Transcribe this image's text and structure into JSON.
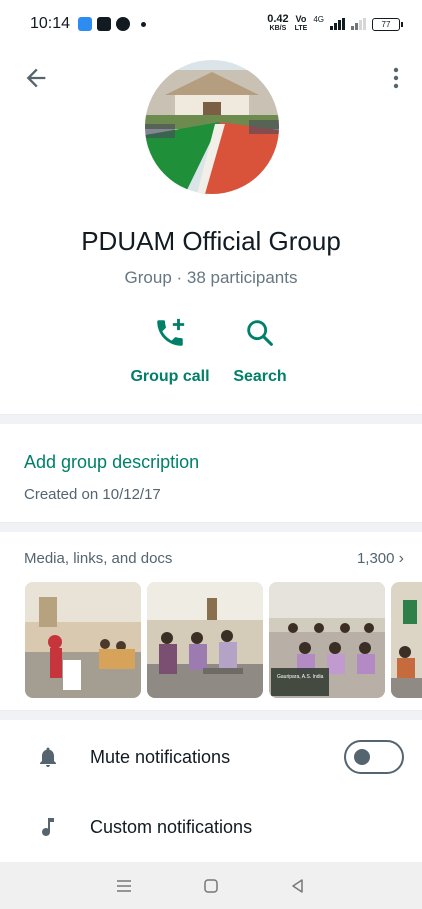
{
  "status_bar": {
    "time": "10:14",
    "speed_value": "0.42",
    "speed_unit": "KB/S",
    "volte": "Vo",
    "lte": "LTE",
    "net": "4G",
    "battery": "77"
  },
  "group": {
    "name": "PDUAM Official Group",
    "subtitle": "Group · 38 participants"
  },
  "actions": [
    {
      "label": "Group call",
      "icon": "add-call-icon"
    },
    {
      "label": "Search",
      "icon": "search-icon"
    }
  ],
  "description": {
    "add_label": "Add group description",
    "created": "Created on 10/12/17"
  },
  "media": {
    "title": "Media, links, and docs",
    "count": "1,300",
    "thumb_caption": "Gauripara, A.S. India"
  },
  "settings": [
    {
      "label": "Mute notifications",
      "icon": "bell-icon",
      "toggle": false
    },
    {
      "label": "Custom notifications",
      "icon": "music-note-icon"
    }
  ],
  "colors": {
    "accent": "#008069",
    "secondary_text": "#667781"
  }
}
